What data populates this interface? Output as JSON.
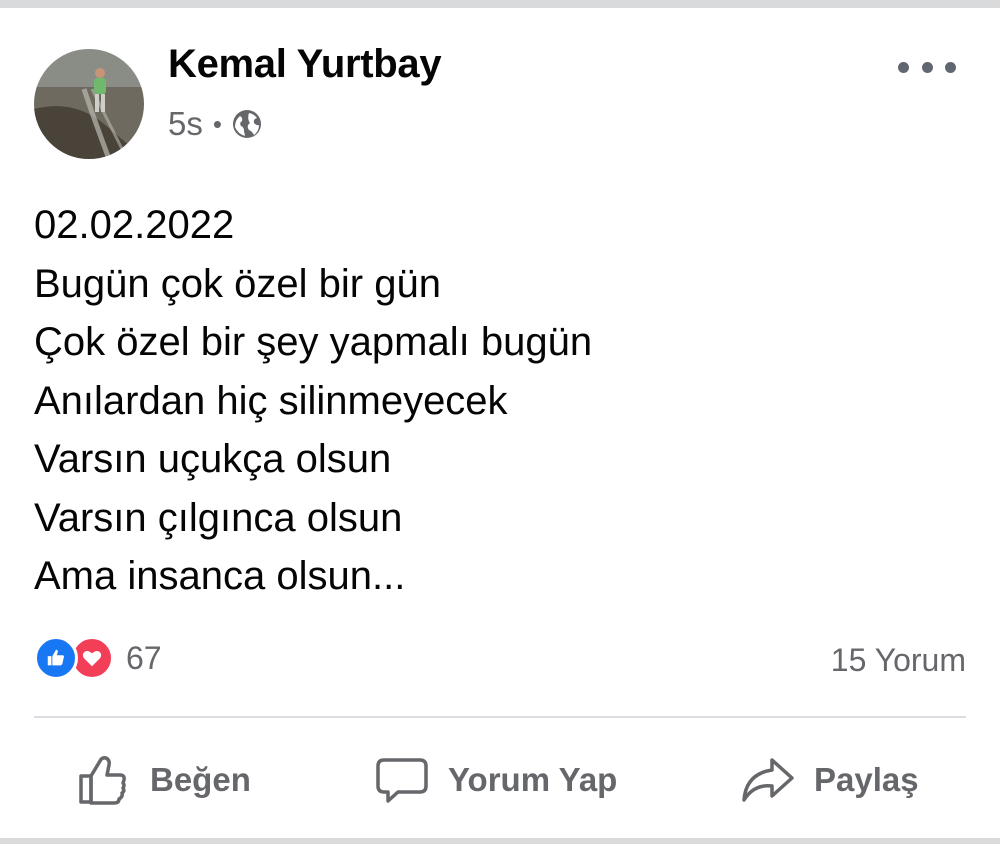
{
  "post": {
    "author": "Kemal Yurtbay",
    "time": "5s",
    "separator": "•",
    "privacy_icon": "globe-icon",
    "menu_icon": "more-options-icon",
    "lines": [
      "02.02.2022",
      "Bugün çok özel bir gün",
      "Çok özel bir şey yapmalı bugün",
      "Anılardan hiç silinmeyecek",
      "Varsın uçukça olsun",
      "Varsın çılgınca olsun",
      "Ama insanca olsun..."
    ]
  },
  "stats": {
    "reaction_icons": [
      "like-reaction-icon",
      "love-reaction-icon"
    ],
    "reaction_count": "67",
    "comments": "15 Yorum"
  },
  "actions": {
    "like": "Beğen",
    "comment": "Yorum Yap",
    "share": "Paylaş"
  },
  "colors": {
    "like_blue": "#1877f2",
    "love_red": "#f33e58",
    "secondary_text": "#65676b"
  }
}
